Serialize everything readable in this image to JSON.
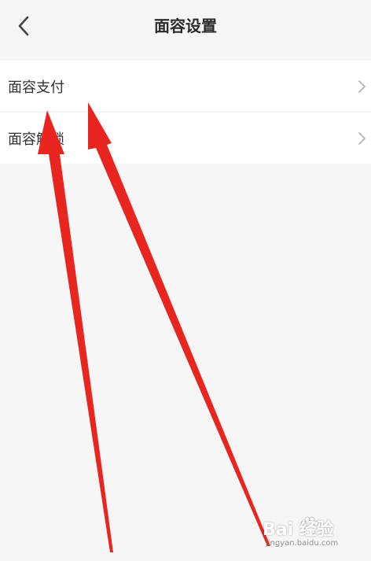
{
  "header": {
    "title": "面容设置",
    "back_icon": "chevron-left-icon"
  },
  "settings": {
    "items": [
      {
        "label": "面容支付",
        "icon": "chevron-right-icon"
      },
      {
        "label": "面容解锁",
        "icon": "chevron-right-icon"
      }
    ]
  },
  "watermark": {
    "brand": "Bai 经验",
    "url": "jingyan.baidu.com"
  },
  "colors": {
    "background": "#f6f6f6",
    "card": "#ffffff",
    "title_text": "#2b2b2b",
    "item_text": "#333333",
    "chevron": "#b3b3b3",
    "annotation_arrow": "#e8261f"
  }
}
